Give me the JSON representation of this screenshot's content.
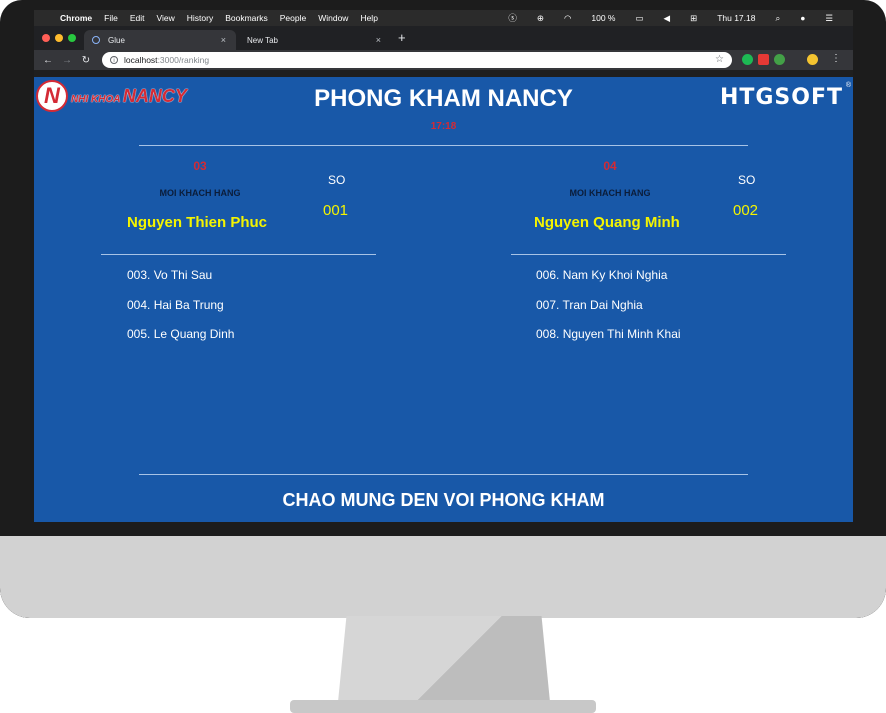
{
  "mac_menubar": {
    "app": "Chrome",
    "menus": [
      "File",
      "Edit",
      "View",
      "History",
      "Bookmarks",
      "People",
      "Window",
      "Help"
    ],
    "battery": "100 %",
    "clock": "Thu 17.18"
  },
  "browser": {
    "tabs": [
      {
        "label": "Glue",
        "close": "×"
      },
      {
        "label": "New Tab",
        "close": "×"
      }
    ],
    "new_tab": "+",
    "url_host": "localhost",
    "url_path": ":3000/ranking"
  },
  "page": {
    "logo_left": {
      "mark": "N",
      "small": "NHI KHOA",
      "big": "NANCY"
    },
    "title": "PHONG KHAM NANCY",
    "time": "17:18",
    "logo_right": "HTGSOFT",
    "logo_right_mark": "®",
    "footer": "CHAO MUNG DEN VOI PHONG KHAM",
    "rooms": [
      {
        "room": "03",
        "invite_label": "MOI KHACH HANG",
        "so_label": "SO",
        "current_number": "001",
        "current_patient": "Nguyen Thien Phuc",
        "queue": [
          "003. Vo Thi Sau",
          "004. Hai Ba Trung",
          "005. Le Quang Dinh"
        ]
      },
      {
        "room": "04",
        "invite_label": "MOI KHACH HANG",
        "so_label": "SO",
        "current_number": "002",
        "current_patient": "Nguyen Quang Minh",
        "queue": [
          "006. Nam Ky Khoi Nghia",
          "007. Tran Dai Nghia",
          "008. Nguyen Thi Minh Khai"
        ]
      }
    ]
  }
}
